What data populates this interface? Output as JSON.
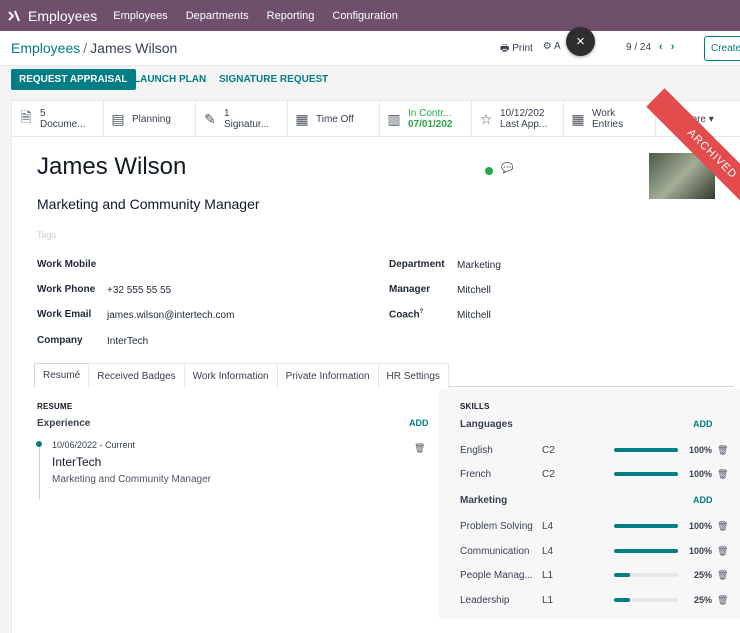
{
  "topbar": {
    "app_name": "Employees",
    "menus": [
      "Employees",
      "Departments",
      "Reporting",
      "Configuration"
    ]
  },
  "breadcrumb": {
    "parent": "Employees",
    "current": "James Wilson"
  },
  "actions": {
    "print": "Print",
    "action": "A"
  },
  "pager": {
    "value": "9 / 24"
  },
  "create_label": "Create",
  "close_label": "×",
  "statusbar": {
    "request_appraisal": "REQUEST APPRAISAL",
    "launch_plan": "LAUNCH PLAN",
    "signature_request": "SIGNATURE REQUEST"
  },
  "smart_buttons": [
    {
      "icon": "file-icon",
      "glyph": "🗎",
      "line1": "5",
      "line2": "Docume..."
    },
    {
      "icon": "planning-icon",
      "glyph": "▤",
      "line1": "Planning",
      "line2": ""
    },
    {
      "icon": "pen-icon",
      "glyph": "✎",
      "line1": "1",
      "line2": "Signatur..."
    },
    {
      "icon": "calendar-icon",
      "glyph": "▦",
      "line1": "Time Off",
      "line2": ""
    },
    {
      "icon": "contract-icon",
      "glyph": "▥",
      "line1": "In Contr...",
      "line2": "07/01/202"
    },
    {
      "icon": "star-icon",
      "glyph": "☆",
      "line1": "10/12/202",
      "line2": "Last App..."
    },
    {
      "icon": "work-entries-icon",
      "glyph": "▦",
      "line1": "Work",
      "line2": "Entries"
    },
    {
      "icon": "",
      "glyph": "",
      "line1": "More ▾",
      "line2": ""
    }
  ],
  "ribbon": "ARCHIVED",
  "employee": {
    "name": "James Wilson",
    "job_title": "Marketing and Community Manager",
    "tags_placeholder": "Tags"
  },
  "fields_left": [
    {
      "label": "Work Mobile",
      "value": ""
    },
    {
      "label": "Work Phone",
      "value": "+32 555 55 55"
    },
    {
      "label": "Work Email",
      "value": "james.wilson@intertech.com"
    },
    {
      "label": "Company",
      "value": "InterTech"
    }
  ],
  "fields_right": [
    {
      "label": "Department",
      "value": "Marketing"
    },
    {
      "label": "Manager",
      "value": "Mitchell"
    },
    {
      "label": "Coach",
      "sup": "?",
      "value": "Mitchell"
    }
  ],
  "tabs": [
    "Resumé",
    "Received Badges",
    "Work Information",
    "Private Information",
    "HR Settings"
  ],
  "resume": {
    "section": "RESUME",
    "experience": "Experience",
    "add": "ADD",
    "entry": {
      "date": "10/06/2022 - Current",
      "company": "InterTech",
      "role": "Marketing and Community Manager"
    }
  },
  "skills": {
    "section": "SKILLS",
    "groups": [
      {
        "name": "Languages",
        "add": "ADD",
        "items": [
          {
            "name": "English",
            "level": "C2",
            "progress": 100,
            "pct": "100%"
          },
          {
            "name": "French",
            "level": "C2",
            "progress": 100,
            "pct": "100%"
          }
        ]
      },
      {
        "name": "Marketing",
        "add": "ADD",
        "items": [
          {
            "name": "Problem Solving",
            "level": "L4",
            "progress": 100,
            "pct": "100%"
          },
          {
            "name": "Communication",
            "level": "L4",
            "progress": 100,
            "pct": "100%"
          },
          {
            "name": "People Manag...",
            "level": "L1",
            "progress": 25,
            "pct": "25%"
          },
          {
            "name": "Leadership",
            "level": "L1",
            "progress": 25,
            "pct": "25%"
          }
        ]
      }
    ]
  },
  "colors": {
    "brand": "#6f4f6c",
    "accent": "#017e84",
    "ribbon": "#e24c4c",
    "online": "#28a745"
  }
}
